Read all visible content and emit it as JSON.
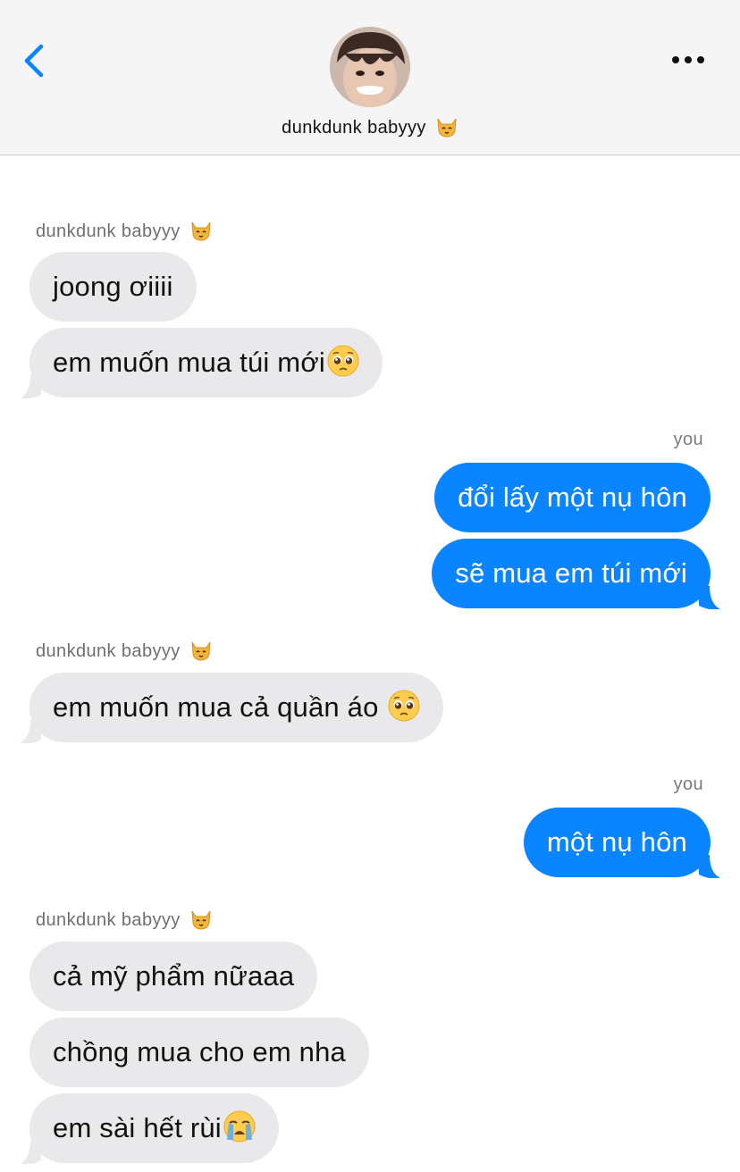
{
  "header": {
    "contact_name": "dunkdunk babyyy",
    "contact_emoji": "cat-face-icon"
  },
  "colors": {
    "outgoing": "#0a84ff",
    "incoming": "#e9e9eb",
    "header_bg": "#f5f5f5"
  },
  "messages": [
    {
      "sender": "dunkdunk babyyy",
      "sender_emoji": "cat-face-icon",
      "side": "incoming",
      "bubbles": [
        {
          "text": "joong ơiiii"
        },
        {
          "text": "em muốn mua túi mới",
          "emoji": "pleading-face-icon"
        }
      ]
    },
    {
      "sender": "you",
      "side": "outgoing",
      "bubbles": [
        {
          "text": "đổi lấy một nụ hôn"
        },
        {
          "text": "sẽ mua em túi mới"
        }
      ]
    },
    {
      "sender": "dunkdunk babyyy",
      "sender_emoji": "cat-face-icon",
      "side": "incoming",
      "bubbles": [
        {
          "text": "em muốn mua cả quần áo ",
          "emoji": "pleading-face-icon"
        }
      ]
    },
    {
      "sender": "you",
      "side": "outgoing",
      "bubbles": [
        {
          "text": "một nụ hôn"
        }
      ]
    },
    {
      "sender": "dunkdunk babyyy",
      "sender_emoji": "cat-face-icon",
      "side": "incoming",
      "bubbles": [
        {
          "text": "cả mỹ phẩm nữaaa"
        },
        {
          "text": "chồng mua cho em nha"
        },
        {
          "text": "em sài hết rùi",
          "emoji": "crying-face-icon"
        }
      ]
    }
  ]
}
